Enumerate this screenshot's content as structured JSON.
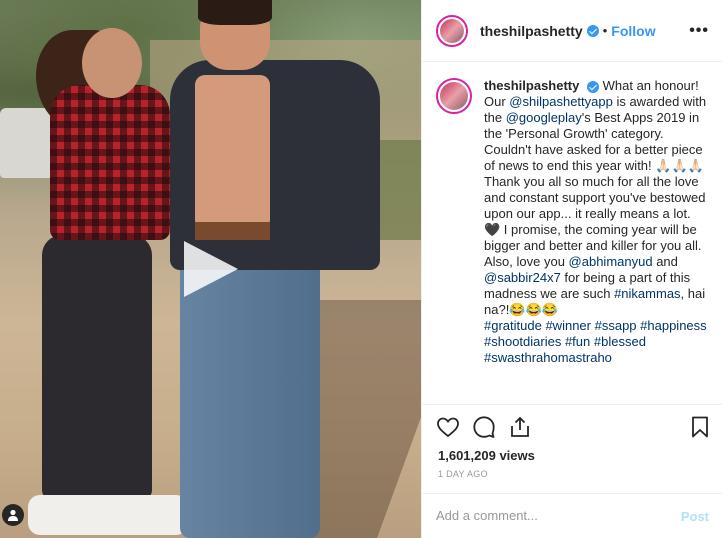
{
  "header": {
    "username": "theshilpashetty",
    "dot": "•",
    "follow_label": "Follow",
    "more_label": "•••"
  },
  "caption": {
    "username": "theshilpashetty",
    "p1_a": "What an honour! Our ",
    "m1": "@shilpashettyapp",
    "p1_b": " is awarded with the ",
    "m2": "@googleplay",
    "p1_c": "'s Best Apps 2019 in the 'Personal Growth' category. Couldn't have asked for a better piece of news to end this year with! 🙏🏻🙏🏻🙏🏻",
    "p2": "Thank you all so much for all the love and constant support you've bestowed upon our app... it really means a lot. 🖤 I promise, the coming year will be bigger and better and killer for you all.",
    "p3_a": "Also, love you ",
    "m3": "@abhimanyud",
    "p3_b": " and ",
    "m4": "@sabbir24x7",
    "p3_c": " for being a part of this madness we are such ",
    "h1": "#nikammas",
    "p3_d": ", hai na?!😂😂😂",
    "h2": "#gratitude",
    "h3": "#winner",
    "h4": "#ssapp",
    "h5": "#happiness",
    "h6": "#shootdiaries",
    "h7": "#fun",
    "h8": "#blessed",
    "h9": "#swasthrahomastraho"
  },
  "stats": {
    "views": "1,601,209 views",
    "time": "1 DAY AGO"
  },
  "comment": {
    "placeholder": "Add a comment...",
    "post_label": "Post"
  },
  "icons": {
    "like": "heart-icon",
    "comment": "comment-icon",
    "share": "share-icon",
    "save": "bookmark-icon",
    "play": "play-icon",
    "tag": "user-tag-icon"
  },
  "colors": {
    "link": "#003569",
    "follow": "#3897f0",
    "post_disabled": "#b2dffc",
    "story_ring": "#d6249f"
  }
}
